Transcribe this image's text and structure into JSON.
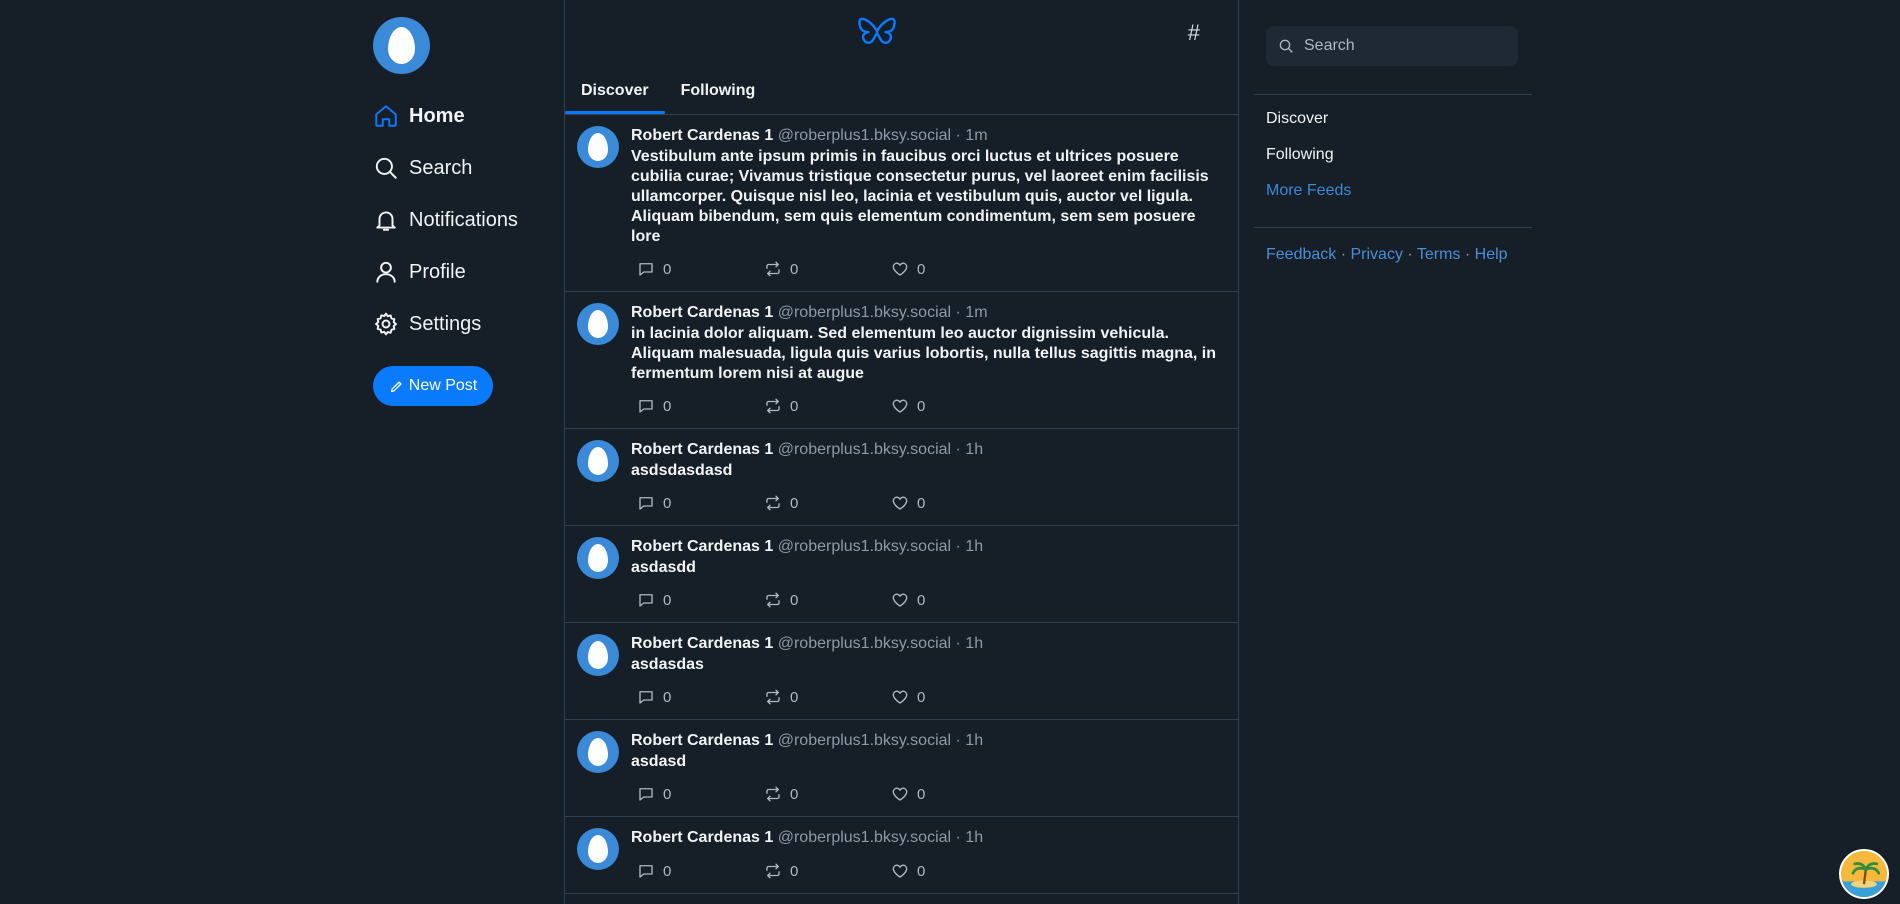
{
  "nav": {
    "items": [
      {
        "label": "Home",
        "icon": "home-icon",
        "active": true
      },
      {
        "label": "Search",
        "icon": "search-icon",
        "active": false
      },
      {
        "label": "Notifications",
        "icon": "bell-icon",
        "active": false
      },
      {
        "label": "Profile",
        "icon": "user-icon",
        "active": false
      },
      {
        "label": "Settings",
        "icon": "gear-icon",
        "active": false
      }
    ],
    "new_post_label": "New Post"
  },
  "header": {
    "logo_icon": "butterfly-icon",
    "hash_label": "#"
  },
  "tabs": [
    {
      "label": "Discover",
      "active": true
    },
    {
      "label": "Following",
      "active": false
    }
  ],
  "posts": [
    {
      "name": "Robert Cardenas 1",
      "handle": "@roberplus1.bksy.social",
      "sep": " · ",
      "time": "1m",
      "text": "Vestibulum ante ipsum primis in faucibus orci luctus et ultrices posuere cubilia curae; Vivamus tristique consectetur purus, vel laoreet enim facilisis ullamcorper. Quisque nisl leo, lacinia et vestibulum quis, auctor vel ligula. Aliquam bibendum, sem quis elementum condimentum, sem sem posuere lore",
      "replies": "0",
      "reposts": "0",
      "likes": "0"
    },
    {
      "name": "Robert Cardenas 1",
      "handle": "@roberplus1.bksy.social",
      "sep": " · ",
      "time": "1m",
      "text": "in lacinia dolor aliquam. Sed elementum leo auctor dignissim vehicula. Aliquam malesuada, ligula quis varius lobortis, nulla tellus sagittis magna, in fermentum lorem nisi at augue",
      "replies": "0",
      "reposts": "0",
      "likes": "0"
    },
    {
      "name": "Robert Cardenas 1",
      "handle": "@roberplus1.bksy.social",
      "sep": " · ",
      "time": "1h",
      "text": "asdsdasdasd",
      "replies": "0",
      "reposts": "0",
      "likes": "0"
    },
    {
      "name": "Robert Cardenas 1",
      "handle": "@roberplus1.bksy.social",
      "sep": " · ",
      "time": "1h",
      "text": "asdasdd",
      "replies": "0",
      "reposts": "0",
      "likes": "0"
    },
    {
      "name": "Robert Cardenas 1",
      "handle": "@roberplus1.bksy.social",
      "sep": " · ",
      "time": "1h",
      "text": "asdasdas",
      "replies": "0",
      "reposts": "0",
      "likes": "0"
    },
    {
      "name": "Robert Cardenas 1",
      "handle": "@roberplus1.bksy.social",
      "sep": " · ",
      "time": "1h",
      "text": "asdasd",
      "replies": "0",
      "reposts": "0",
      "likes": "0"
    },
    {
      "name": "Robert Cardenas 1",
      "handle": "@roberplus1.bksy.social",
      "sep": " · ",
      "time": "1h",
      "text": "",
      "replies": "0",
      "reposts": "0",
      "likes": "0"
    }
  ],
  "sidebar": {
    "search_placeholder": "Search",
    "feeds": [
      "Discover",
      "Following"
    ],
    "more_feeds": "More Feeds",
    "footer": {
      "feedback": "Feedback",
      "privacy": "Privacy",
      "terms": "Terms",
      "help": "Help",
      "sep": " · "
    }
  },
  "colors": {
    "accent": "#0a7aff",
    "background": "#161e27",
    "link": "#4c8fd6"
  }
}
